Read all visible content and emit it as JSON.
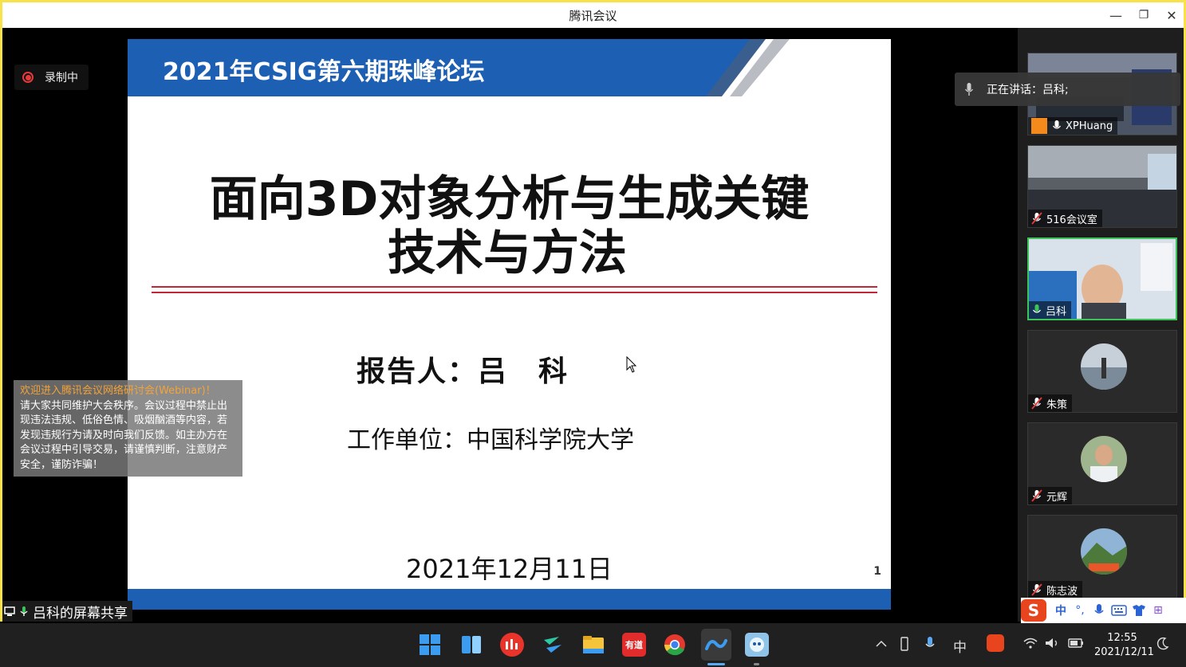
{
  "window": {
    "title": "腾讯会议",
    "minimize_glyph": "—",
    "restore_glyph": "❐",
    "close_glyph": "✕"
  },
  "recording": {
    "label": "录制中"
  },
  "slide": {
    "header_title": "2021年CSIG第六期珠峰论坛",
    "main_title_line1": "面向3D对象分析与生成关键",
    "main_title_line2": "技术与方法",
    "reporter": "报告人：吕　科",
    "unit": "工作单位：中国科学院大学",
    "date": "2021年12月11日",
    "page_number": "1"
  },
  "notice": {
    "line1": "欢迎进入腾讯会议网络研讨会(Webinar)！",
    "body": "请大家共同维护大会秩序。会议过程中禁止出现违法违规、低俗色情、吸烟酗酒等内容，若发现违规行为请及时向我们反馈。如主办方在会议过程中引导交易，请谨慎判断，注意财产安全，谨防诈骗！"
  },
  "share_label": "吕科的屏幕共享",
  "speaking": {
    "label": "正在讲话：吕科;"
  },
  "participants": [
    {
      "name": "XPHuang",
      "mic": "on"
    },
    {
      "name": "516会议室",
      "mic": "muted"
    },
    {
      "name": "吕科",
      "mic": "on",
      "active": true
    },
    {
      "name": "朱策",
      "mic": "muted"
    },
    {
      "name": "元辉",
      "mic": "muted"
    },
    {
      "name": "陈志波",
      "mic": "muted"
    }
  ],
  "ime": {
    "logo": "S",
    "mode": "中",
    "punct": "°,",
    "grid": "⊞"
  },
  "taskbar": {
    "apps": [
      "start-icon",
      "widgets-icon",
      "jianying-icon",
      "feishu-icon",
      "file-explorer-icon",
      "youdao-icon",
      "chrome-icon",
      "tencent-meeting-icon",
      "game-icon"
    ],
    "youdao_label": "有道",
    "tray_ime": "中",
    "time": "12:55",
    "date": "2021/12/11"
  }
}
